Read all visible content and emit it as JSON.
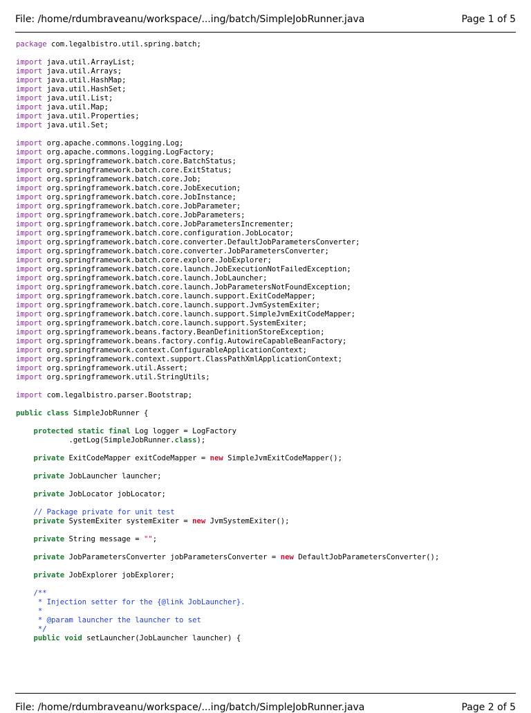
{
  "header": {
    "file_label": "File: /home/rdumbraveanu/workspace/...ing/batch/SimpleJobRunner.java",
    "page_label": "Page 1 of 5"
  },
  "code_lines": [
    [
      [
        "pkg",
        "package"
      ],
      [
        "t",
        " com.legalbistro.util.spring.batch;"
      ]
    ],
    [],
    [
      [
        "pkg",
        "import"
      ],
      [
        "t",
        " java.util.ArrayList;"
      ]
    ],
    [
      [
        "pkg",
        "import"
      ],
      [
        "t",
        " java.util.Arrays;"
      ]
    ],
    [
      [
        "pkg",
        "import"
      ],
      [
        "t",
        " java.util.HashMap;"
      ]
    ],
    [
      [
        "pkg",
        "import"
      ],
      [
        "t",
        " java.util.HashSet;"
      ]
    ],
    [
      [
        "pkg",
        "import"
      ],
      [
        "t",
        " java.util.List;"
      ]
    ],
    [
      [
        "pkg",
        "import"
      ],
      [
        "t",
        " java.util.Map;"
      ]
    ],
    [
      [
        "pkg",
        "import"
      ],
      [
        "t",
        " java.util.Properties;"
      ]
    ],
    [
      [
        "pkg",
        "import"
      ],
      [
        "t",
        " java.util.Set;"
      ]
    ],
    [],
    [
      [
        "pkg",
        "import"
      ],
      [
        "t",
        " org.apache.commons.logging.Log;"
      ]
    ],
    [
      [
        "pkg",
        "import"
      ],
      [
        "t",
        " org.apache.commons.logging.LogFactory;"
      ]
    ],
    [
      [
        "pkg",
        "import"
      ],
      [
        "t",
        " org.springframework.batch.core.BatchStatus;"
      ]
    ],
    [
      [
        "pkg",
        "import"
      ],
      [
        "t",
        " org.springframework.batch.core.ExitStatus;"
      ]
    ],
    [
      [
        "pkg",
        "import"
      ],
      [
        "t",
        " org.springframework.batch.core.Job;"
      ]
    ],
    [
      [
        "pkg",
        "import"
      ],
      [
        "t",
        " org.springframework.batch.core.JobExecution;"
      ]
    ],
    [
      [
        "pkg",
        "import"
      ],
      [
        "t",
        " org.springframework.batch.core.JobInstance;"
      ]
    ],
    [
      [
        "pkg",
        "import"
      ],
      [
        "t",
        " org.springframework.batch.core.JobParameter;"
      ]
    ],
    [
      [
        "pkg",
        "import"
      ],
      [
        "t",
        " org.springframework.batch.core.JobParameters;"
      ]
    ],
    [
      [
        "pkg",
        "import"
      ],
      [
        "t",
        " org.springframework.batch.core.JobParametersIncrementer;"
      ]
    ],
    [
      [
        "pkg",
        "import"
      ],
      [
        "t",
        " org.springframework.batch.core.configuration.JobLocator;"
      ]
    ],
    [
      [
        "pkg",
        "import"
      ],
      [
        "t",
        " org.springframework.batch.core.converter.DefaultJobParametersConverter;"
      ]
    ],
    [
      [
        "pkg",
        "import"
      ],
      [
        "t",
        " org.springframework.batch.core.converter.JobParametersConverter;"
      ]
    ],
    [
      [
        "pkg",
        "import"
      ],
      [
        "t",
        " org.springframework.batch.core.explore.JobExplorer;"
      ]
    ],
    [
      [
        "pkg",
        "import"
      ],
      [
        "t",
        " org.springframework.batch.core.launch.JobExecutionNotFailedException;"
      ]
    ],
    [
      [
        "pkg",
        "import"
      ],
      [
        "t",
        " org.springframework.batch.core.launch.JobLauncher;"
      ]
    ],
    [
      [
        "pkg",
        "import"
      ],
      [
        "t",
        " org.springframework.batch.core.launch.JobParametersNotFoundException;"
      ]
    ],
    [
      [
        "pkg",
        "import"
      ],
      [
        "t",
        " org.springframework.batch.core.launch.support.ExitCodeMapper;"
      ]
    ],
    [
      [
        "pkg",
        "import"
      ],
      [
        "t",
        " org.springframework.batch.core.launch.support.JvmSystemExiter;"
      ]
    ],
    [
      [
        "pkg",
        "import"
      ],
      [
        "t",
        " org.springframework.batch.core.launch.support.SimpleJvmExitCodeMapper;"
      ]
    ],
    [
      [
        "pkg",
        "import"
      ],
      [
        "t",
        " org.springframework.batch.core.launch.support.SystemExiter;"
      ]
    ],
    [
      [
        "pkg",
        "import"
      ],
      [
        "t",
        " org.springframework.beans.factory.BeanDefinitionStoreException;"
      ]
    ],
    [
      [
        "pkg",
        "import"
      ],
      [
        "t",
        " org.springframework.beans.factory.config.AutowireCapableBeanFactory;"
      ]
    ],
    [
      [
        "pkg",
        "import"
      ],
      [
        "t",
        " org.springframework.context.ConfigurableApplicationContext;"
      ]
    ],
    [
      [
        "pkg",
        "import"
      ],
      [
        "t",
        " org.springframework.context.support.ClassPathXmlApplicationContext;"
      ]
    ],
    [
      [
        "pkg",
        "import"
      ],
      [
        "t",
        " org.springframework.util.Assert;"
      ]
    ],
    [
      [
        "pkg",
        "import"
      ],
      [
        "t",
        " org.springframework.util.StringUtils;"
      ]
    ],
    [],
    [
      [
        "pkg",
        "import"
      ],
      [
        "t",
        " com.legalbistro.parser.Bootstrap;"
      ]
    ],
    [],
    [
      [
        "kw",
        "public"
      ],
      [
        "t",
        " "
      ],
      [
        "kw",
        "class"
      ],
      [
        "t",
        " SimpleJobRunner {"
      ]
    ],
    [],
    [
      [
        "t",
        "    "
      ],
      [
        "kw",
        "protected"
      ],
      [
        "t",
        " "
      ],
      [
        "kw",
        "static"
      ],
      [
        "t",
        " "
      ],
      [
        "kw",
        "final"
      ],
      [
        "t",
        " Log logger = LogFactory"
      ]
    ],
    [
      [
        "t",
        "            .getLog(SimpleJobRunner."
      ],
      [
        "kw",
        "class"
      ],
      [
        "t",
        ");"
      ]
    ],
    [],
    [
      [
        "t",
        "    "
      ],
      [
        "kw",
        "private"
      ],
      [
        "t",
        " ExitCodeMapper exitCodeMapper = "
      ],
      [
        "new",
        "new"
      ],
      [
        "t",
        " SimpleJvmExitCodeMapper();"
      ]
    ],
    [],
    [
      [
        "t",
        "    "
      ],
      [
        "kw",
        "private"
      ],
      [
        "t",
        " JobLauncher launcher;"
      ]
    ],
    [],
    [
      [
        "t",
        "    "
      ],
      [
        "kw",
        "private"
      ],
      [
        "t",
        " JobLocator jobLocator;"
      ]
    ],
    [],
    [
      [
        "cm",
        "    // Package private for unit test"
      ]
    ],
    [
      [
        "t",
        "    "
      ],
      [
        "kw",
        "private"
      ],
      [
        "t",
        " SystemExiter systemExiter = "
      ],
      [
        "new",
        "new"
      ],
      [
        "t",
        " JvmSystemExiter();"
      ]
    ],
    [],
    [
      [
        "t",
        "    "
      ],
      [
        "kw",
        "private"
      ],
      [
        "t",
        " String message = "
      ],
      [
        "str",
        "\"\""
      ],
      [
        "t",
        ";"
      ]
    ],
    [],
    [
      [
        "t",
        "    "
      ],
      [
        "kw",
        "private"
      ],
      [
        "t",
        " JobParametersConverter jobParametersConverter = "
      ],
      [
        "new",
        "new"
      ],
      [
        "t",
        " DefaultJobParametersConverter();"
      ]
    ],
    [],
    [
      [
        "t",
        "    "
      ],
      [
        "kw",
        "private"
      ],
      [
        "t",
        " JobExplorer jobExplorer;"
      ]
    ],
    [],
    [
      [
        "cm",
        "    /**"
      ]
    ],
    [
      [
        "cm",
        "     * Injection setter for the {@link JobLauncher}."
      ]
    ],
    [
      [
        "cm",
        "     *"
      ]
    ],
    [
      [
        "cm",
        "     * @param launcher the launcher to set"
      ]
    ],
    [
      [
        "cm",
        "     */"
      ]
    ],
    [
      [
        "t",
        "    "
      ],
      [
        "kw",
        "public"
      ],
      [
        "t",
        " "
      ],
      [
        "kw",
        "void"
      ],
      [
        "t",
        " setLauncher(JobLauncher launcher) {"
      ]
    ]
  ],
  "footer": {
    "file_label": "File: /home/rdumbraveanu/workspace/...ing/batch/SimpleJobRunner.java",
    "page_label": "Page 2 of 5"
  }
}
